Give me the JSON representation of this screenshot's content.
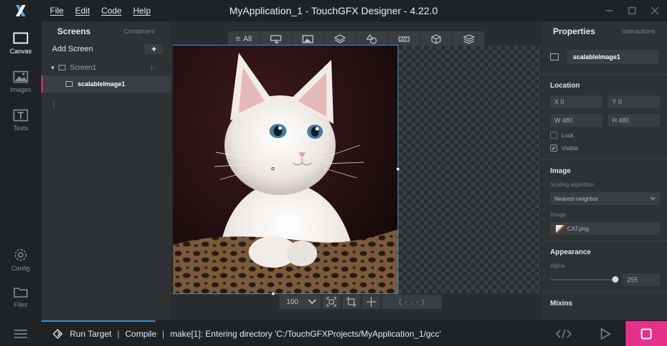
{
  "menu": [
    "File",
    "Edit",
    "Code",
    "Help"
  ],
  "window_title": "MyApplication_1 - TouchGFX Designer - 4.22.0",
  "rail": {
    "canvas": "Canvas",
    "images": "Images",
    "texts": "Texts",
    "config": "Config",
    "files": "Files"
  },
  "screens_panel": {
    "tab_screens": "Screens",
    "tab_containers": "Containers",
    "add_screen": "Add Screen",
    "add_icon": "+",
    "screen_name": "Screen1",
    "widget_name": "scalableImage1"
  },
  "canvas": {
    "toolbar_all": "All",
    "zoom": "100",
    "coord": "( - , - )"
  },
  "props": {
    "tab_properties": "Properties",
    "tab_interactions": "Interactions",
    "name": "scalableImage1",
    "location_title": "Location",
    "x_label": "X",
    "x": "0",
    "y_label": "Y",
    "y": "0",
    "w_label": "W",
    "w": "480",
    "h_label": "H",
    "h": "480",
    "lock": "Lock",
    "visible": "Visible",
    "image_title": "Image",
    "scaling_label": "Scaling algorithm",
    "scaling_value": "Nearest-neighbor",
    "image_label": "Image",
    "image_file": "CAT.png",
    "appearance_title": "Appearance",
    "alpha_label": "Alpha",
    "alpha_value": "255",
    "alpha_level": 1.0,
    "mixins_title": "Mixins"
  },
  "status": {
    "run_target": "Run Target",
    "compile": "Compile",
    "message": "make[1]: Entering directory 'C:/TouchGFXProjects/MyApplication_1/gcc'"
  },
  "colors": {
    "accent": "#e6318a",
    "selection": "#3b8fd6"
  }
}
